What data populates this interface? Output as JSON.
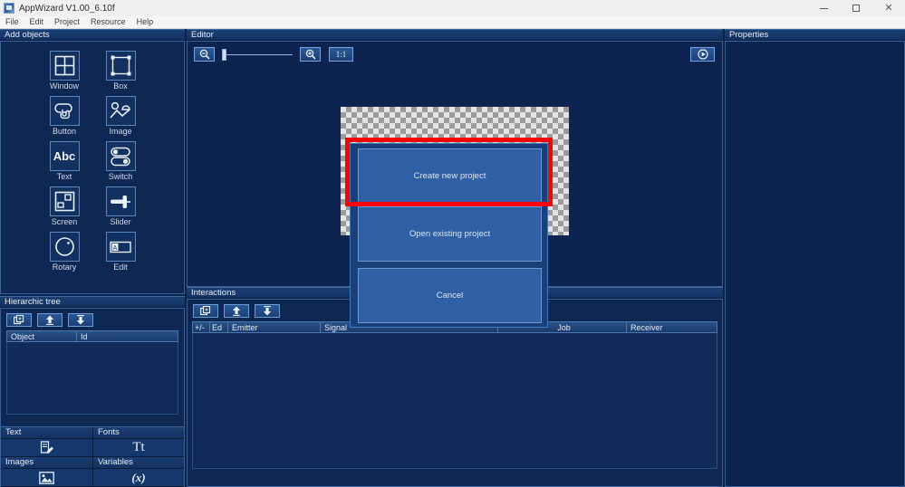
{
  "window": {
    "title": "AppWizard V1.00_6.10f",
    "app_icon": "app-icon",
    "controls": {
      "minimize": "minimize-icon",
      "maximize": "maximize-icon",
      "close": "close-icon"
    }
  },
  "menu": {
    "items": [
      {
        "label": "File"
      },
      {
        "label": "Edit"
      },
      {
        "label": "Project"
      },
      {
        "label": "Resource"
      },
      {
        "label": "Help"
      }
    ]
  },
  "add_objects": {
    "title": "Add objects",
    "items": [
      {
        "label": "Window",
        "icon": "window-icon"
      },
      {
        "label": "Box",
        "icon": "box-icon"
      },
      {
        "label": "Button",
        "icon": "button-icon"
      },
      {
        "label": "Image",
        "icon": "image-icon"
      },
      {
        "label": "Text",
        "icon": "text-icon"
      },
      {
        "label": "Switch",
        "icon": "switch-icon"
      },
      {
        "label": "Screen",
        "icon": "screen-icon"
      },
      {
        "label": "Slider",
        "icon": "slider-icon"
      },
      {
        "label": "Rotary",
        "icon": "rotary-icon"
      },
      {
        "label": "Edit",
        "icon": "edit-icon"
      }
    ]
  },
  "hierarchic_tree": {
    "title": "Hierarchic tree",
    "toolbar": [
      {
        "name": "add-item-button",
        "icon": "add-window-icon"
      },
      {
        "name": "move-up-button",
        "icon": "arrow-up-icon"
      },
      {
        "name": "move-down-button",
        "icon": "arrow-down-icon"
      }
    ],
    "columns": [
      "Object",
      "Id"
    ],
    "rows": []
  },
  "resources": {
    "text": {
      "title": "Text",
      "icon": "text-edit-icon"
    },
    "fonts": {
      "title": "Fonts",
      "icon": "font-icon",
      "glyph": "Tt"
    },
    "images": {
      "title": "Images",
      "icon": "picture-icon"
    },
    "variables": {
      "title": "Variables",
      "icon": "variable-icon",
      "glyph": "(x)"
    }
  },
  "editor": {
    "title": "Editor",
    "toolbar": {
      "zoom_out": "zoom-out-icon",
      "zoom_slider_value": 0,
      "zoom_in": "zoom-in-icon",
      "ratio_label": "1:1",
      "run": "play-icon"
    },
    "canvas": {
      "transparency": "checkerboard"
    }
  },
  "dialog": {
    "buttons": [
      {
        "label": "Create new project",
        "highlighted": true
      },
      {
        "label": "Open existing project",
        "highlighted": false
      },
      {
        "label": "Cancel",
        "highlighted": false
      }
    ]
  },
  "interactions": {
    "title": "Interactions",
    "toolbar": [
      {
        "name": "add-interaction-button",
        "icon": "add-window-icon"
      },
      {
        "name": "move-up-button",
        "icon": "arrow-up-icon"
      },
      {
        "name": "move-down-button",
        "icon": "arrow-down-icon"
      }
    ],
    "columns": [
      "+/-",
      "Ed",
      "Emitter",
      "Signal",
      "Job",
      "Receiver"
    ],
    "rows": []
  },
  "properties": {
    "title": "Properties",
    "rows": []
  },
  "colors": {
    "panel_bg": "#0e2450",
    "panel_header": "#1b3f72",
    "accent_border": "#3a6298",
    "button_face": "#2f5fa4",
    "highlight": "#ff0000",
    "text": "#e3ebf6"
  }
}
